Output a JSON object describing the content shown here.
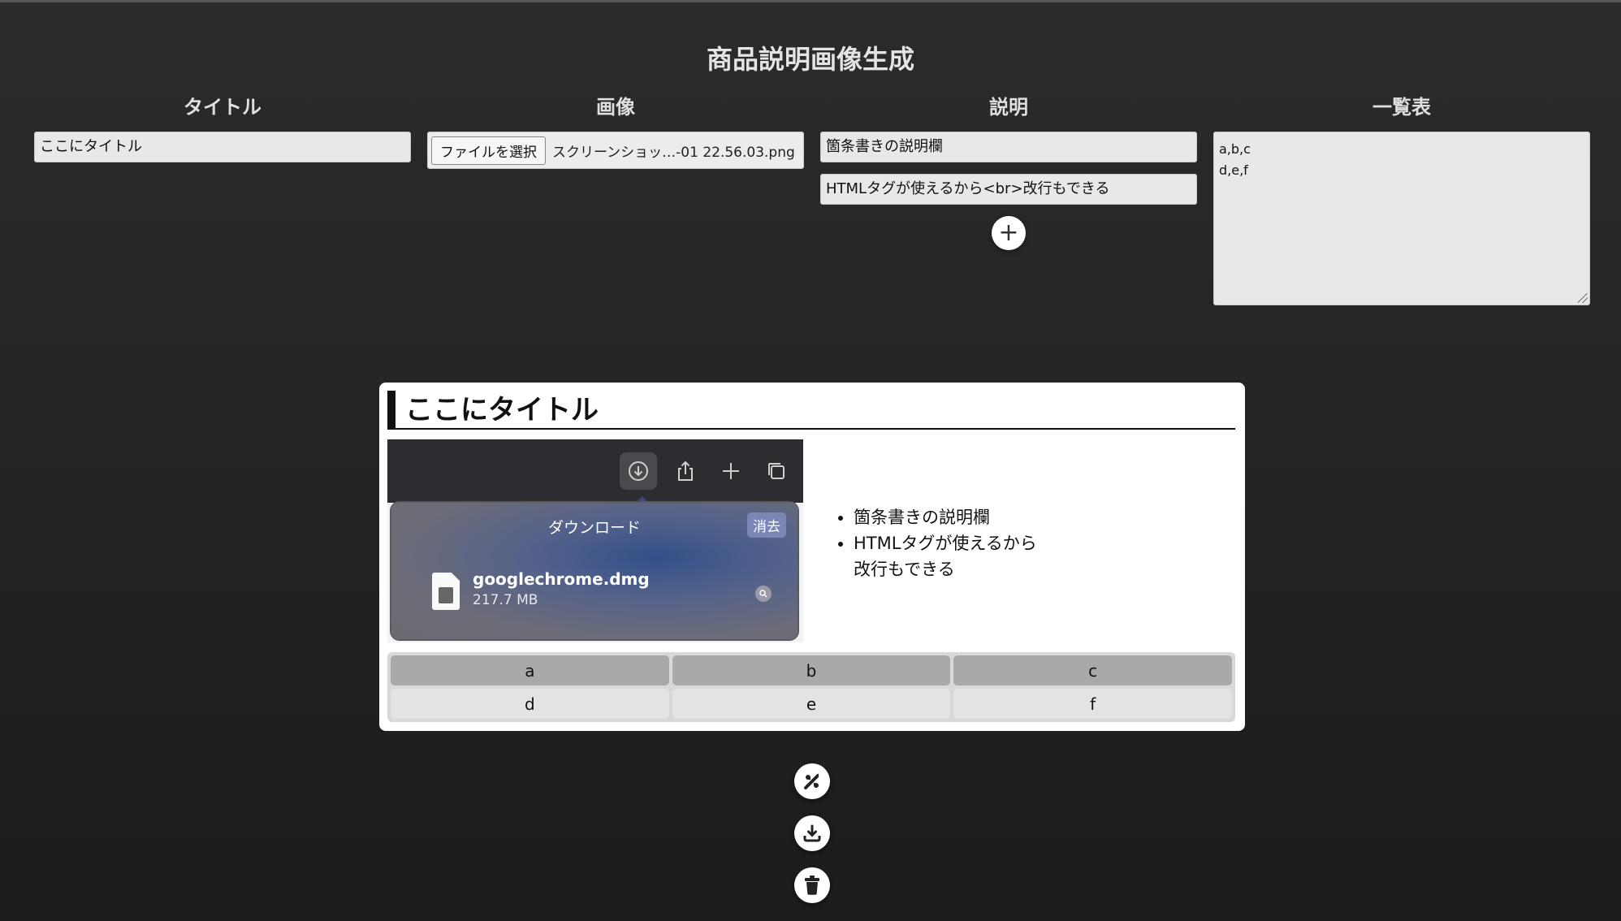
{
  "app": {
    "title": "商品説明画像生成"
  },
  "columns": {
    "title": {
      "heading": "タイトル",
      "value": "ここにタイトル"
    },
    "image": {
      "heading": "画像",
      "file_button": "ファイルを選択",
      "file_name": "スクリーンショッ…-01 22.56.03.png"
    },
    "description": {
      "heading": "説明",
      "items": [
        "箇条書きの説明欄",
        "HTMLタグが使えるから<br>改行もできる"
      ],
      "add_button": "+"
    },
    "list": {
      "heading": "一覧表",
      "lines": [
        "a,b,c",
        "d,e,f"
      ]
    }
  },
  "preview": {
    "title": "ここにタイトル",
    "screenshot": {
      "panel_title": "ダウンロード",
      "clear_label": "消去",
      "file_name": "googlechrome.dmg",
      "file_size": "217.7 MB",
      "toolbar_icons": [
        "download-icon",
        "share-icon",
        "plus-icon",
        "tabs-icon"
      ]
    },
    "bullets": [
      "箇条書きの説明欄",
      "HTMLタグが使えるから",
      "改行もできる"
    ],
    "table": {
      "header": [
        "a",
        "b",
        "c"
      ],
      "rows": [
        [
          "d",
          "e",
          "f"
        ]
      ]
    }
  },
  "actions": [
    "magic-wand-icon",
    "download-icon",
    "trash-icon"
  ],
  "colors": {
    "background": "#222222",
    "card": "#ffffff",
    "table_header": "#a9a9a9",
    "table_cell": "#e3e3e3"
  }
}
